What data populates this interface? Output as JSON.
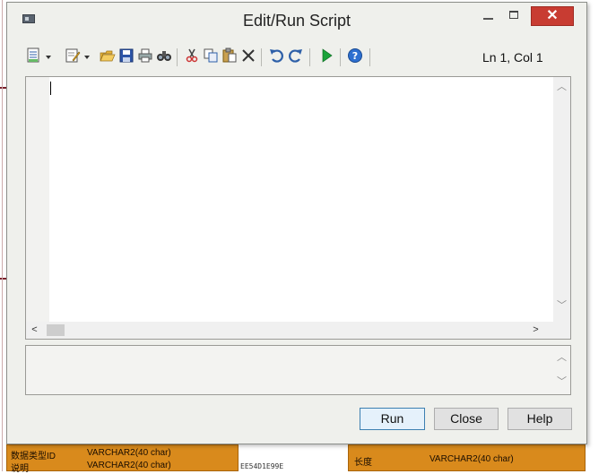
{
  "window": {
    "title": "Edit/Run Script",
    "close_glyph": "✕"
  },
  "toolbar": {
    "items": [
      {
        "icon": "script-menu-icon"
      },
      {
        "icon": "edit-menu-icon"
      },
      {
        "icon": "open-folder-icon"
      },
      {
        "icon": "save-icon"
      },
      {
        "icon": "print-icon"
      },
      {
        "icon": "find-icon"
      },
      {
        "icon": "cut-icon"
      },
      {
        "icon": "copy-icon"
      },
      {
        "icon": "paste-icon"
      },
      {
        "icon": "delete-icon"
      },
      {
        "icon": "undo-icon"
      },
      {
        "icon": "redo-icon"
      },
      {
        "icon": "run-icon"
      },
      {
        "icon": "help-icon"
      }
    ],
    "cursor_position": "Ln 1, Col 1"
  },
  "editor": {
    "content": ""
  },
  "output": {
    "content": ""
  },
  "buttons": {
    "run": "Run",
    "close": "Close",
    "help": "Help"
  },
  "background": {
    "left_panel": [
      {
        "name": "数据类型ID",
        "type": "VARCHAR2(40 char)"
      },
      {
        "name": "说明",
        "type": "VARCHAR2(40 char)"
      }
    ],
    "right_panel": [
      {
        "name": "长度",
        "type": "VARCHAR2(40 char)"
      }
    ],
    "mid_code": "EE54D1E99E"
  },
  "colors": {
    "accent": "#3c7fb1",
    "close_button": "#c83c32",
    "background_panel": "#d98a1c"
  }
}
